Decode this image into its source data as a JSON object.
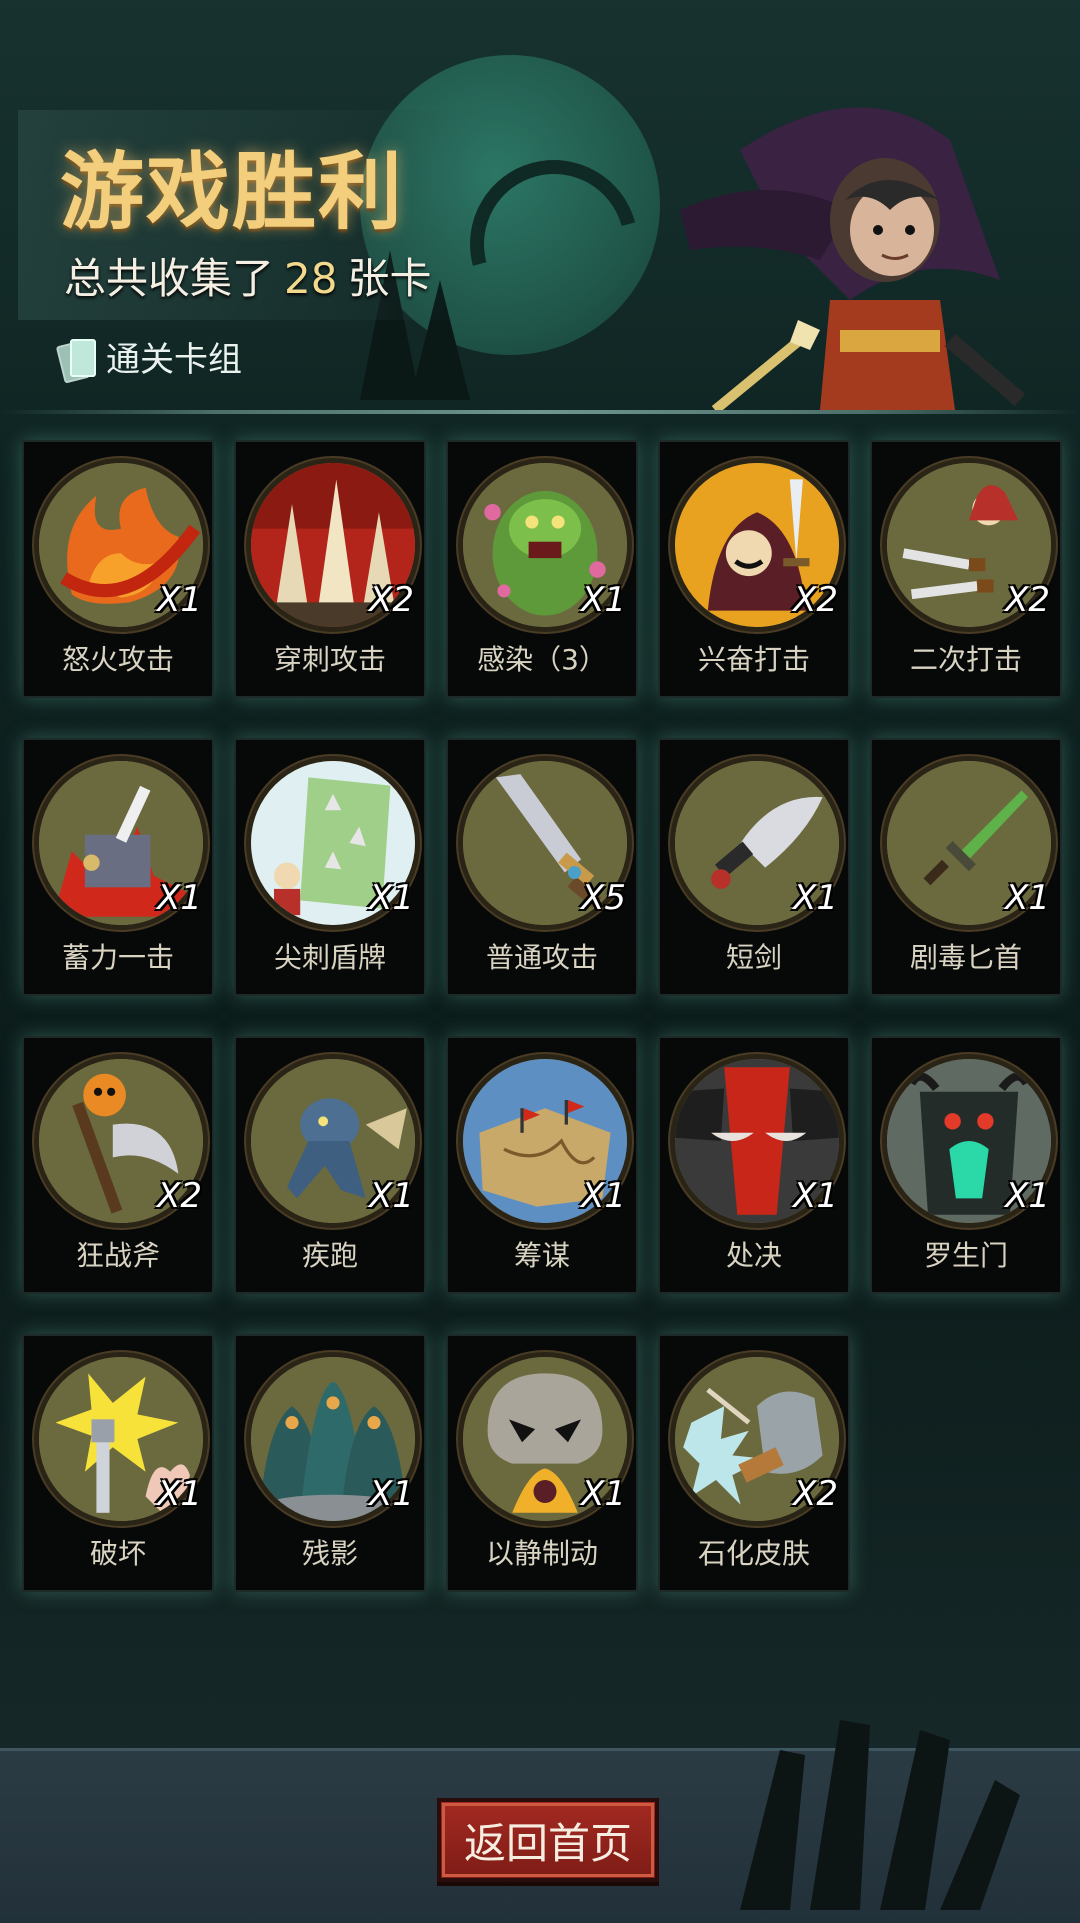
{
  "header": {
    "title": "游戏胜利",
    "subtitle_prefix": "总共收集了",
    "card_total": "28",
    "subtitle_suffix": "张卡",
    "deck_label": "通关卡组"
  },
  "cards": [
    {
      "name": "怒火攻击",
      "qty": "X1",
      "icon": "flame-slash-icon"
    },
    {
      "name": "穿刺攻击",
      "qty": "X2",
      "icon": "spikes-icon"
    },
    {
      "name": "感染（3）",
      "qty": "X1",
      "icon": "zombie-icon"
    },
    {
      "name": "兴奋打击",
      "qty": "X2",
      "icon": "hooded-warrior-icon"
    },
    {
      "name": "二次打击",
      "qty": "X2",
      "icon": "double-dagger-icon"
    },
    {
      "name": "蓄力一击",
      "qty": "X1",
      "icon": "hammer-icon"
    },
    {
      "name": "尖刺盾牌",
      "qty": "X1",
      "icon": "spiked-shield-icon"
    },
    {
      "name": "普通攻击",
      "qty": "X5",
      "icon": "sword-icon"
    },
    {
      "name": "短剑",
      "qty": "X1",
      "icon": "short-sword-icon"
    },
    {
      "name": "剧毒匕首",
      "qty": "X1",
      "icon": "poison-dagger-icon"
    },
    {
      "name": "狂战斧",
      "qty": "X2",
      "icon": "axe-icon"
    },
    {
      "name": "疾跑",
      "qty": "X1",
      "icon": "running-beast-icon"
    },
    {
      "name": "筹谋",
      "qty": "X1",
      "icon": "map-icon"
    },
    {
      "name": "处决",
      "qty": "X1",
      "icon": "execution-icon"
    },
    {
      "name": "罗生门",
      "qty": "X1",
      "icon": "demon-gate-icon"
    },
    {
      "name": "破坏",
      "qty": "X1",
      "icon": "mace-burst-icon"
    },
    {
      "name": "残影",
      "qty": "X1",
      "icon": "shadow-clones-icon"
    },
    {
      "name": "以静制动",
      "qty": "X1",
      "icon": "skull-icon"
    },
    {
      "name": "石化皮肤",
      "qty": "X2",
      "icon": "stone-fist-icon"
    }
  ],
  "footer": {
    "home_button": "返回首页"
  },
  "colors": {
    "title": "#f3cf7d",
    "button": "#a32a22",
    "card_glow": "#6ebeaa"
  }
}
